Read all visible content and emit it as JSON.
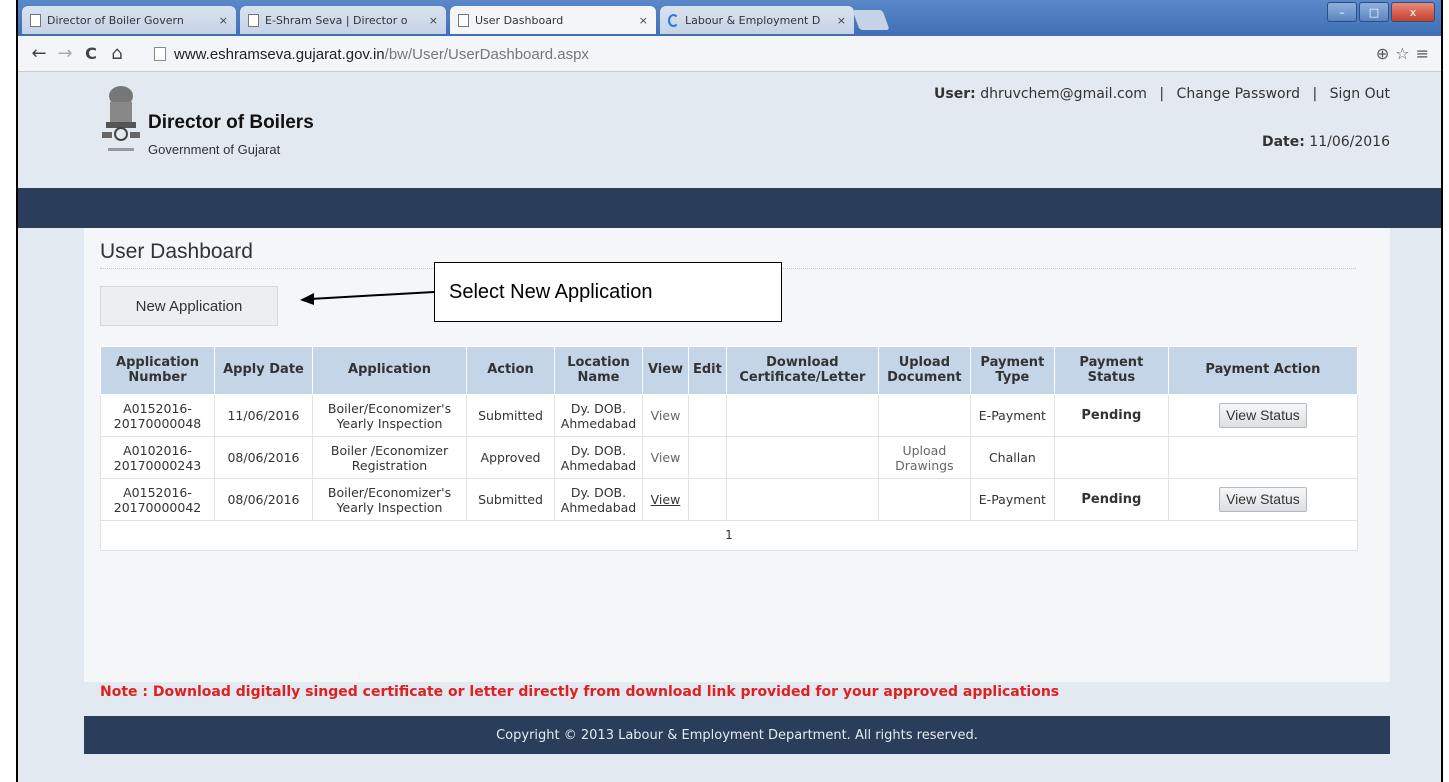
{
  "browser": {
    "tabs": [
      {
        "label": "Director of Boiler Govern",
        "active": false
      },
      {
        "label": "E-Shram Seva | Director o",
        "active": false
      },
      {
        "label": "User Dashboard",
        "active": true
      },
      {
        "label": "Labour & Employment D",
        "active": false
      }
    ],
    "tab_close": "×",
    "url_host": "www.eshramseva.gujarat.gov.in",
    "url_path": "/bw/User/UserDashboard.aspx",
    "back_icon": "back-arrow-icon",
    "window_buttons": {
      "minimize": "–",
      "maximize": "□",
      "close": "x"
    },
    "nav_glyphs": {
      "back": "←",
      "forward": "→",
      "reload": "C",
      "home": "⌂"
    },
    "right_glyphs": {
      "zoom": "⊕",
      "star": "☆",
      "menu": "≡"
    }
  },
  "header": {
    "site_title": "Director of Boilers",
    "site_subtitle": "Government of Gujarat",
    "user_label": "User:",
    "user_email": "dhruvchem@gmail.com",
    "separator": "|",
    "change_password": "Change Password",
    "sign_out": "Sign Out",
    "date_label": "Date:",
    "date_value": "11/06/2016"
  },
  "dashboard": {
    "title": "User Dashboard",
    "new_application_label": "New Application",
    "callout_text": "Select New Application",
    "columns": [
      "Application Number",
      "Apply Date",
      "Application",
      "Action",
      "Location Name",
      "View",
      "Edit",
      "Download Certificate/Letter",
      "Upload Document",
      "Payment Type",
      "Payment Status",
      "Payment Action"
    ],
    "rows": [
      {
        "number": "A0152016-20170000048",
        "date": "11/06/2016",
        "application": "Boiler/Economizer's Yearly Inspection",
        "action": "Submitted",
        "location": "Dy. DOB. Ahmedabad",
        "view": "View",
        "edit": "",
        "download": "",
        "upload": "",
        "payment_type": "E-Payment",
        "payment_status": "Pending",
        "payment_action": "View Status"
      },
      {
        "number": "A0102016-20170000243",
        "date": "08/06/2016",
        "application": "Boiler /Economizer Registration",
        "action": "Approved",
        "location": "Dy. DOB. Ahmedabad",
        "view": "View",
        "edit": "",
        "download": "",
        "upload": "Upload Drawings",
        "payment_type": "Challan",
        "payment_status": "",
        "payment_action": ""
      },
      {
        "number": "A0152016-20170000042",
        "date": "08/06/2016",
        "application": "Boiler/Economizer's Yearly Inspection",
        "action": "Submitted",
        "location": "Dy. DOB. Ahmedabad",
        "view": "View",
        "edit": "",
        "download": "",
        "upload": "",
        "payment_type": "E-Payment",
        "payment_status": "Pending",
        "payment_action": "View Status"
      }
    ],
    "page_number": "1",
    "note": "Note : Download digitally singed certificate or letter directly from download link provided for your approved applications"
  },
  "footer": {
    "copyright": "Copyright © 2013 Labour & Employment Department. All rights reserved."
  },
  "colors": {
    "nav_bar": "#2a3d5a",
    "table_header": "#c5d5e8",
    "note_red": "#e02020"
  }
}
